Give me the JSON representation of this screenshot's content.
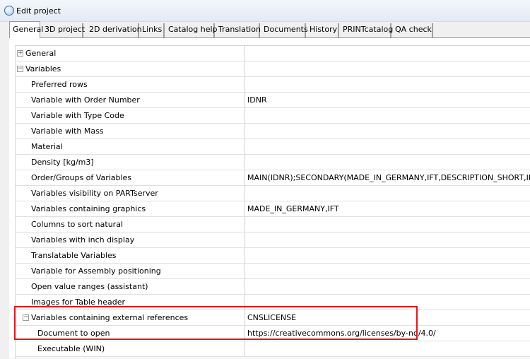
{
  "window": {
    "title": "Edit project"
  },
  "tabs": [
    {
      "label": "General",
      "active": true
    },
    {
      "label": "3D project"
    },
    {
      "label": "2D derivation"
    },
    {
      "label": "Links"
    },
    {
      "label": "Catalog help"
    },
    {
      "label": "Translation"
    },
    {
      "label": "Documents"
    },
    {
      "label": "History"
    },
    {
      "label": "PRINTcatalog"
    },
    {
      "label": "QA check"
    }
  ],
  "rows": [
    {
      "label": "General",
      "value": "",
      "toggle": "+"
    },
    {
      "label": "Variables",
      "value": "",
      "toggle": "−"
    },
    {
      "label": "Preferred rows",
      "value": ""
    },
    {
      "label": "Variable with Order Number",
      "value": "IDNR"
    },
    {
      "label": "Variable with Type Code",
      "value": ""
    },
    {
      "label": "Variable with Mass",
      "value": ""
    },
    {
      "label": "Material",
      "value": ""
    },
    {
      "label": "Density [kg/m3]",
      "value": ""
    },
    {
      "label": "Order/Groups of Variables",
      "value": "MAIN(IDNR);SECONDARY(MADE_IN_GERMANY,IFT,DESCRIPTION_SHORT,INTERNATIC"
    },
    {
      "label": "Variables visibility on PARTserver",
      "value": ""
    },
    {
      "label": "Variables containing graphics",
      "value": "MADE_IN_GERMANY,IFT"
    },
    {
      "label": "Columns to sort natural",
      "value": ""
    },
    {
      "label": "Variables with inch display",
      "value": ""
    },
    {
      "label": "Translatable Variables",
      "value": ""
    },
    {
      "label": "Variable for Assembly positioning",
      "value": ""
    },
    {
      "label": "Open value ranges (assistant)",
      "value": ""
    },
    {
      "label": "Images for Table header",
      "value": ""
    },
    {
      "label": "Variables containing external references",
      "value": "CNSLICENSE",
      "toggle": "−"
    },
    {
      "label": "Document to open",
      "value": "https://creativecommons.org/licenses/by-nd/4.0/"
    },
    {
      "label": "Executable (WIN)",
      "value": ""
    }
  ]
}
